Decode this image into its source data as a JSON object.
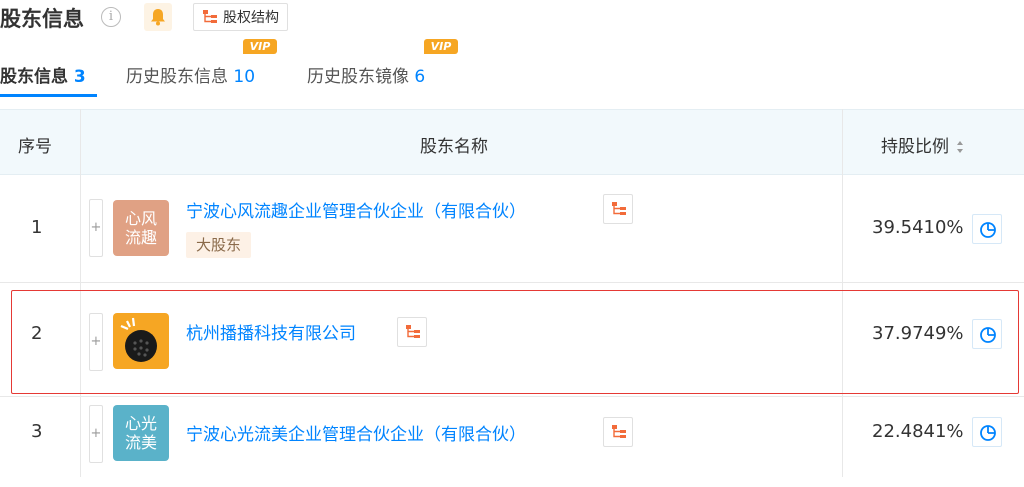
{
  "header": {
    "title": "股东信息",
    "info_icon": "info-icon",
    "bell_icon": "bell-icon",
    "equity_button_label": "股权结构"
  },
  "tabs": [
    {
      "label": "股东信息",
      "count": "3",
      "active": true,
      "vip": false
    },
    {
      "label": "历史股东信息",
      "count": "10",
      "active": false,
      "vip": true
    },
    {
      "label": "历史股东镜像",
      "count": "6",
      "active": false,
      "vip": true
    }
  ],
  "vip_label": "VIP",
  "table": {
    "columns": {
      "index": "序号",
      "name": "股东名称",
      "ratio": "持股比例"
    },
    "sort_icon": "sort-icon",
    "rows": [
      {
        "index": "1",
        "logo_text": "心风流趣",
        "logo_color": "#e0a184",
        "name": "宁波心风流趣企业管理合伙企业（有限合伙）",
        "tag": "大股东",
        "ratio": "39.5410%"
      },
      {
        "index": "2",
        "logo_text": "",
        "logo_color": "#f6a623",
        "name": "杭州播播科技有限公司",
        "tag": "",
        "ratio": "37.9749%"
      },
      {
        "index": "3",
        "logo_text": "心光流美",
        "logo_color": "#5ab2c9",
        "name": "宁波心光流美企业管理合伙企业（有限合伙）",
        "tag": "",
        "ratio": "22.4841%"
      }
    ]
  },
  "colors": {
    "accent": "#0084ff",
    "highlight": "#e53935",
    "vip": "#f6a623"
  }
}
